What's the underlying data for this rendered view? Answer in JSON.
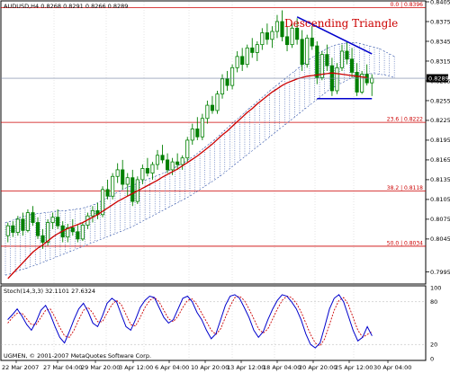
{
  "symbol_info": "AUDUSD,H4  0.8268 0.8291 0.8266 0.8289",
  "annotation": "Descending Triangle",
  "current_price": "0.8289",
  "indicator_title": "Stoch(14,3,3) 32.1101 27.6324",
  "copyright": "UGMEN, © 2001-2007 MetaQuotes Software Corp.",
  "fibonacci": [
    {
      "label": "0.0 | 0.8396",
      "price": 0.8396
    },
    {
      "label": "23.6 | 0.8222",
      "price": 0.8222
    },
    {
      "label": "38.2 | 0.8118",
      "price": 0.8118
    },
    {
      "label": "50.0 | 0.8034",
      "price": 0.8034
    }
  ],
  "colors": {
    "fib_line": "#cc0000",
    "candles": "#008000",
    "ma": "#cc0000",
    "cloud": "#3355aa",
    "trendline": "#0000cc",
    "stoch_main": "#0000cc",
    "stoch_signal": "#cc0000"
  },
  "chart_data": {
    "type": "candlestick",
    "price_axis": {
      "ticks": [
        0.7995,
        0.8045,
        0.8075,
        0.8105,
        0.8135,
        0.8165,
        0.8195,
        0.8225,
        0.8255,
        0.8285,
        0.8315,
        0.8345,
        0.8375,
        0.8405
      ],
      "tick_labels": [
        "0.7995",
        "0.8045",
        "0.8075",
        "0.8105",
        "0.8135",
        "0.8165",
        "0.8195",
        "0.8225",
        "0.8255",
        "0.8285",
        "0.8315",
        "0.8345",
        "0.8375",
        "0.8405"
      ],
      "range": [
        0.7978,
        0.8405
      ]
    },
    "stoch_axis": {
      "ticks": [
        100,
        80,
        20,
        0
      ],
      "tick_labels": [
        "100",
        "80",
        "20",
        "0"
      ]
    },
    "time_labels": [
      "22 Mar 2007",
      "27 Mar 04:00",
      "29 Mar 20:00",
      "3 Apr 12:00",
      "6 Apr 04:00",
      "10 Apr 20:00",
      "13 Apr 12:00",
      "18 Apr 04:00",
      "20 Apr 20:00",
      "25 Apr 12:00",
      "30 Apr 04:00"
    ],
    "candles": [
      [
        0.805,
        0.807,
        0.804,
        0.8065
      ],
      [
        0.8065,
        0.8072,
        0.8048,
        0.8055
      ],
      [
        0.8055,
        0.808,
        0.805,
        0.8075
      ],
      [
        0.8075,
        0.8085,
        0.805,
        0.8058
      ],
      [
        0.8058,
        0.809,
        0.8055,
        0.8085
      ],
      [
        0.8085,
        0.8095,
        0.8065,
        0.807
      ],
      [
        0.807,
        0.8078,
        0.8045,
        0.805
      ],
      [
        0.805,
        0.806,
        0.803,
        0.804
      ],
      [
        0.804,
        0.8075,
        0.8035,
        0.807
      ],
      [
        0.807,
        0.8085,
        0.806,
        0.8078
      ],
      [
        0.8078,
        0.809,
        0.806,
        0.8065
      ],
      [
        0.8065,
        0.8072,
        0.804,
        0.8048
      ],
      [
        0.8048,
        0.8068,
        0.804,
        0.8062
      ],
      [
        0.8062,
        0.8075,
        0.805,
        0.8056
      ],
      [
        0.8056,
        0.8066,
        0.804,
        0.8045
      ],
      [
        0.8045,
        0.807,
        0.8042,
        0.8066
      ],
      [
        0.8066,
        0.8085,
        0.806,
        0.808
      ],
      [
        0.808,
        0.8095,
        0.807,
        0.8088
      ],
      [
        0.8088,
        0.81,
        0.8075,
        0.8082
      ],
      [
        0.8082,
        0.8125,
        0.8078,
        0.812
      ],
      [
        0.812,
        0.8135,
        0.8105,
        0.811
      ],
      [
        0.811,
        0.8145,
        0.8105,
        0.814
      ],
      [
        0.814,
        0.816,
        0.813,
        0.815
      ],
      [
        0.815,
        0.8165,
        0.812,
        0.8128
      ],
      [
        0.8128,
        0.8145,
        0.811,
        0.8138
      ],
      [
        0.8138,
        0.815,
        0.8095,
        0.8102
      ],
      [
        0.8102,
        0.814,
        0.8098,
        0.8135
      ],
      [
        0.8135,
        0.8158,
        0.8128,
        0.8152
      ],
      [
        0.8152,
        0.8168,
        0.814,
        0.8145
      ],
      [
        0.8145,
        0.8162,
        0.8135,
        0.8158
      ],
      [
        0.8158,
        0.818,
        0.815,
        0.8172
      ],
      [
        0.8172,
        0.8188,
        0.816,
        0.8165
      ],
      [
        0.8165,
        0.8175,
        0.8145,
        0.815
      ],
      [
        0.815,
        0.8168,
        0.8142,
        0.8162
      ],
      [
        0.8162,
        0.8175,
        0.815,
        0.8158
      ],
      [
        0.8158,
        0.8172,
        0.815,
        0.8168
      ],
      [
        0.8168,
        0.82,
        0.8162,
        0.8195
      ],
      [
        0.8195,
        0.822,
        0.8188,
        0.8212
      ],
      [
        0.8212,
        0.823,
        0.8195,
        0.82
      ],
      [
        0.82,
        0.8235,
        0.8195,
        0.8228
      ],
      [
        0.8228,
        0.8255,
        0.822,
        0.8248
      ],
      [
        0.8248,
        0.8262,
        0.8235,
        0.824
      ],
      [
        0.824,
        0.827,
        0.8235,
        0.8265
      ],
      [
        0.8265,
        0.8295,
        0.8258,
        0.8288
      ],
      [
        0.8288,
        0.83,
        0.827,
        0.8278
      ],
      [
        0.8278,
        0.831,
        0.8272,
        0.8305
      ],
      [
        0.8305,
        0.833,
        0.8298,
        0.8322
      ],
      [
        0.8322,
        0.8335,
        0.83,
        0.831
      ],
      [
        0.831,
        0.834,
        0.8305,
        0.8335
      ],
      [
        0.8335,
        0.835,
        0.832,
        0.8328
      ],
      [
        0.8328,
        0.8345,
        0.8315,
        0.834
      ],
      [
        0.834,
        0.8365,
        0.8332,
        0.8358
      ],
      [
        0.8358,
        0.8372,
        0.834,
        0.8348
      ],
      [
        0.8348,
        0.8368,
        0.8335,
        0.836
      ],
      [
        0.836,
        0.8385,
        0.835,
        0.8375
      ],
      [
        0.8375,
        0.8392,
        0.8345,
        0.8352
      ],
      [
        0.8352,
        0.8368,
        0.833,
        0.834
      ],
      [
        0.834,
        0.8372,
        0.8335,
        0.8365
      ],
      [
        0.8365,
        0.838,
        0.834,
        0.8348
      ],
      [
        0.8348,
        0.8362,
        0.83,
        0.831
      ],
      [
        0.831,
        0.8355,
        0.8305,
        0.835
      ],
      [
        0.835,
        0.8368,
        0.8332,
        0.8338
      ],
      [
        0.8338,
        0.8345,
        0.828,
        0.829
      ],
      [
        0.829,
        0.833,
        0.8286,
        0.8325
      ],
      [
        0.8325,
        0.834,
        0.83,
        0.8308
      ],
      [
        0.8308,
        0.832,
        0.8262,
        0.827
      ],
      [
        0.827,
        0.8312,
        0.8265,
        0.8305
      ],
      [
        0.8305,
        0.834,
        0.83,
        0.833
      ],
      [
        0.833,
        0.8345,
        0.831,
        0.8318
      ],
      [
        0.8318,
        0.8335,
        0.829,
        0.8298
      ],
      [
        0.8298,
        0.8312,
        0.8262,
        0.8268
      ],
      [
        0.8268,
        0.83,
        0.8265,
        0.8295
      ],
      [
        0.8295,
        0.831,
        0.8278,
        0.8282
      ],
      [
        0.8282,
        0.8295,
        0.8262,
        0.8289
      ]
    ],
    "moving_average": [
      0.7985,
      0.7993,
      0.8001,
      0.8009,
      0.8017,
      0.8025,
      0.8031,
      0.8036,
      0.8042,
      0.8048,
      0.8053,
      0.8057,
      0.8061,
      0.8064,
      0.8067,
      0.807,
      0.8074,
      0.8078,
      0.8082,
      0.8087,
      0.8092,
      0.8097,
      0.8102,
      0.8106,
      0.811,
      0.8114,
      0.8118,
      0.8122,
      0.8126,
      0.813,
      0.8134,
      0.8139,
      0.8143,
      0.8147,
      0.8151,
      0.8156,
      0.8161,
      0.8166,
      0.8171,
      0.8177,
      0.8183,
      0.8189,
      0.8196,
      0.8203,
      0.8209,
      0.8216,
      0.8223,
      0.823,
      0.8237,
      0.8243,
      0.825,
      0.8256,
      0.8262,
      0.8268,
      0.8273,
      0.8278,
      0.8282,
      0.8285,
      0.8288,
      0.829,
      0.8292,
      0.8293,
      0.8294,
      0.8295,
      0.8296,
      0.8297,
      0.8296,
      0.8295,
      0.8294,
      0.8293,
      0.8292,
      0.8291,
      0.829
    ],
    "cloud_upper": [
      0.807,
      0.8072,
      0.8075,
      0.8078,
      0.808,
      0.8082,
      0.8083,
      0.8084,
      0.8085,
      0.8086,
      0.8087,
      0.8088,
      0.8088,
      0.8089,
      0.809,
      0.8091,
      0.8093,
      0.8095,
      0.8098,
      0.8102,
      0.8106,
      0.811,
      0.8114,
      0.8118,
      0.8122,
      0.8125,
      0.8128,
      0.8131,
      0.8134,
      0.8137,
      0.814,
      0.8143,
      0.8146,
      0.815,
      0.8154,
      0.8158,
      0.8162,
      0.8167,
      0.8172,
      0.8178,
      0.8184,
      0.819,
      0.8196,
      0.8203,
      0.821,
      0.8217,
      0.8224,
      0.823,
      0.8237,
      0.8244,
      0.825,
      0.8257,
      0.8263,
      0.827,
      0.8276,
      0.8282,
      0.8288,
      0.8294,
      0.83,
      0.8306,
      0.8312,
      0.8318,
      0.8323,
      0.8328,
      0.8332,
      0.8336,
      0.8339,
      0.8341,
      0.8342,
      0.8343,
      0.8343,
      0.8342,
      0.834,
      0.8338,
      0.8336,
      0.8334,
      0.833,
      0.8326,
      0.8322
    ],
    "cloud_lower": [
      0.799,
      0.7992,
      0.7995,
      0.7998,
      0.8,
      0.8003,
      0.8005,
      0.8008,
      0.8011,
      0.8014,
      0.8017,
      0.802,
      0.8023,
      0.8026,
      0.8029,
      0.8032,
      0.8035,
      0.8038,
      0.8041,
      0.8044,
      0.8047,
      0.805,
      0.8053,
      0.8056,
      0.8059,
      0.8062,
      0.8066,
      0.807,
      0.8074,
      0.8078,
      0.8082,
      0.8086,
      0.809,
      0.8094,
      0.8098,
      0.8102,
      0.8106,
      0.811,
      0.8115,
      0.812,
      0.8125,
      0.813,
      0.8135,
      0.814,
      0.8146,
      0.8152,
      0.8158,
      0.8164,
      0.817,
      0.8176,
      0.8182,
      0.8188,
      0.8194,
      0.82,
      0.8206,
      0.8212,
      0.8218,
      0.8224,
      0.823,
      0.8236,
      0.8242,
      0.8248,
      0.8254,
      0.826,
      0.8266,
      0.8272,
      0.8276,
      0.828,
      0.8284,
      0.8288,
      0.8291,
      0.8293,
      0.8295,
      0.8296,
      0.8296,
      0.8295,
      0.8294,
      0.8292,
      0.829
    ],
    "triangle": {
      "upper": {
        "start": [
          58,
          0.8382
        ],
        "end": [
          73,
          0.8326
        ]
      },
      "lower": {
        "start": [
          62,
          0.8258
        ],
        "end": [
          73,
          0.8258
        ]
      }
    },
    "stoch_main": [
      55,
      62,
      70,
      60,
      48,
      40,
      52,
      68,
      75,
      62,
      45,
      30,
      22,
      38,
      55,
      70,
      78,
      66,
      50,
      45,
      60,
      78,
      85,
      80,
      62,
      45,
      40,
      55,
      72,
      82,
      88,
      86,
      72,
      58,
      50,
      55,
      70,
      85,
      88,
      80,
      65,
      55,
      40,
      28,
      35,
      55,
      75,
      88,
      90,
      85,
      72,
      58,
      40,
      30,
      38,
      55,
      70,
      82,
      90,
      88,
      80,
      70,
      55,
      35,
      20,
      15,
      22,
      45,
      70,
      85,
      90,
      80,
      60,
      40,
      25,
      30,
      45,
      32
    ],
    "stoch_signal": [
      50,
      58,
      64,
      64,
      56,
      48,
      48,
      58,
      68,
      70,
      58,
      44,
      32,
      30,
      40,
      55,
      68,
      72,
      64,
      52,
      52,
      64,
      76,
      82,
      76,
      62,
      48,
      46,
      58,
      72,
      82,
      86,
      80,
      68,
      56,
      52,
      60,
      72,
      82,
      84,
      76,
      64,
      52,
      40,
      34,
      42,
      58,
      74,
      86,
      88,
      82,
      70,
      56,
      42,
      36,
      42,
      56,
      70,
      82,
      88,
      86,
      78,
      66,
      50,
      34,
      22,
      18,
      28,
      48,
      68,
      82,
      86,
      76,
      58,
      40,
      30,
      34,
      38
    ]
  }
}
